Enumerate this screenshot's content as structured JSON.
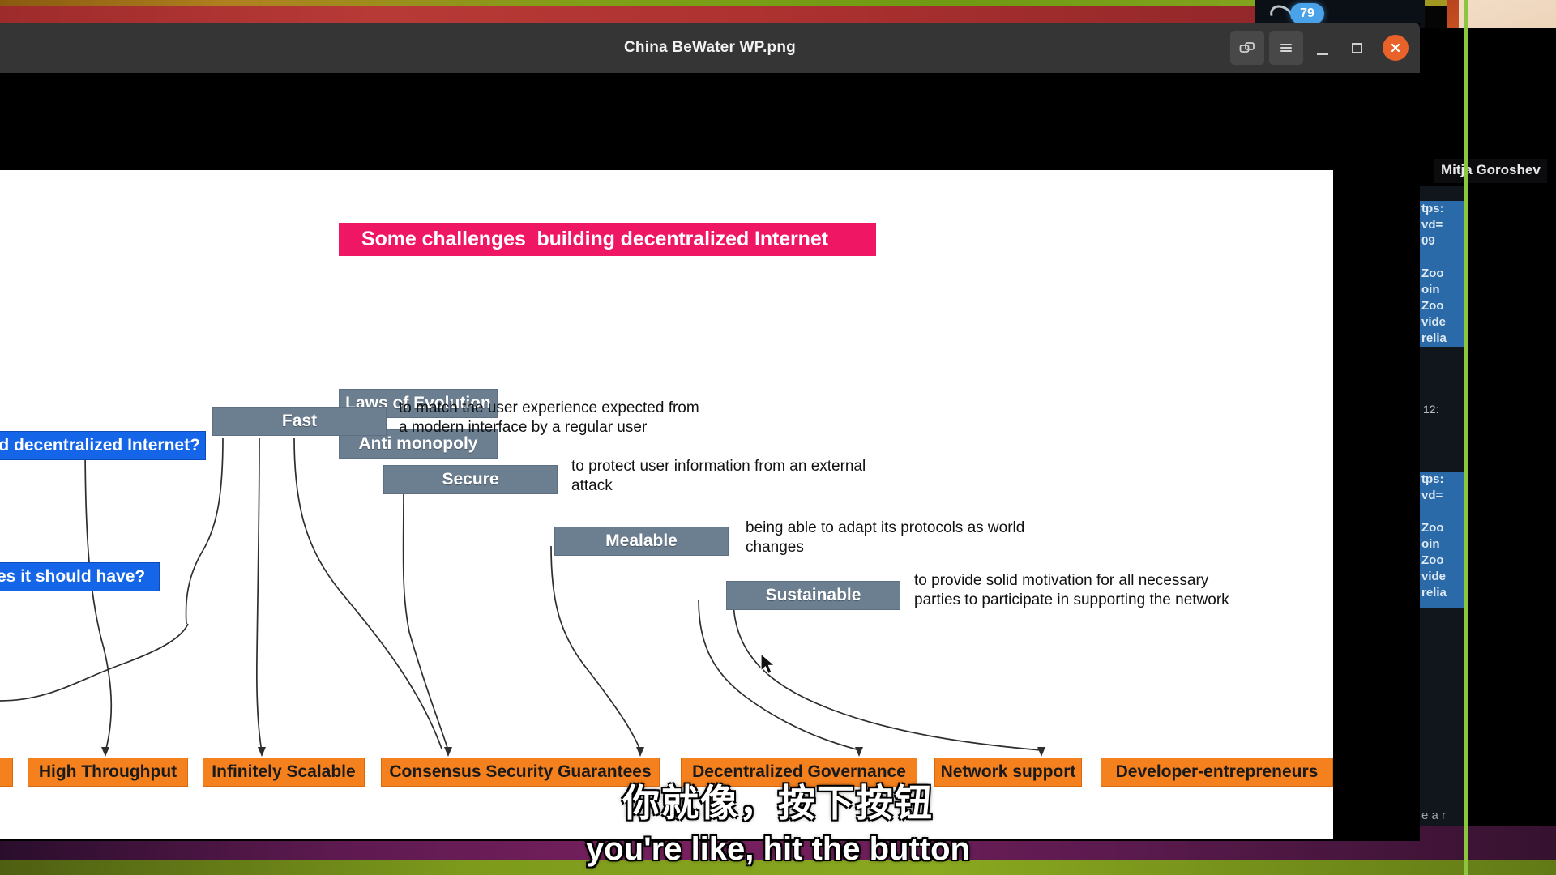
{
  "window": {
    "title": "China BeWater WP.png",
    "controls": {
      "duplicate_label": "Duplicate",
      "menu_label": "Menu",
      "minimize_label": "Minimize",
      "maximize_label": "Maximize",
      "close_label": "Close"
    }
  },
  "call": {
    "participant_count": "79",
    "participant_name": "Mitja Goroshev",
    "chat": {
      "message_one": [
        "tps:",
        "vd=",
        "09",
        "",
        "Zoo",
        "oin",
        "Zoo",
        "vide",
        "relia"
      ],
      "timestamp": "12:",
      "message_two": [
        "tps:",
        "vd=",
        "",
        "Zoo",
        "oin",
        "Zoo",
        "vide",
        "relia"
      ],
      "footer": "e a r"
    }
  },
  "subtitles": {
    "chinese": "你就像，按下按钮",
    "english": "you're like, hit the button"
  },
  "slide": {
    "banner": "Some challenges  building decentralized Internet",
    "questions": [
      {
        "label": "eed decentralized Internet?"
      },
      {
        "label": "rties it should have?"
      }
    ],
    "principles": [
      {
        "label": "Laws of Evolution"
      },
      {
        "label": "Anti monopoly"
      }
    ],
    "properties": [
      {
        "label": "Fast",
        "description": "to match the user experience expected from\na modern interface by a regular user"
      },
      {
        "label": "Secure",
        "description": "to protect user information from an external\nattack"
      },
      {
        "label": "Mealable",
        "description": "being able to adapt its protocols as world\nchanges"
      },
      {
        "label": "Sustainable",
        "description": "to provide solid motivation for all necessary\nparties to participate in supporting the network"
      }
    ],
    "outcomes": [
      {
        "label": "High Throughput"
      },
      {
        "label": "Infinitely Scalable"
      },
      {
        "label": "Consensus Security Guarantees"
      },
      {
        "label": "Decentralized Governance"
      },
      {
        "label": "Network support"
      },
      {
        "label": "Developer-entrepreneurs"
      }
    ],
    "colors": {
      "banner": "#ef1764",
      "question": "#1565e8",
      "property": "#6c7f91",
      "outcome": "#f4801e"
    }
  }
}
